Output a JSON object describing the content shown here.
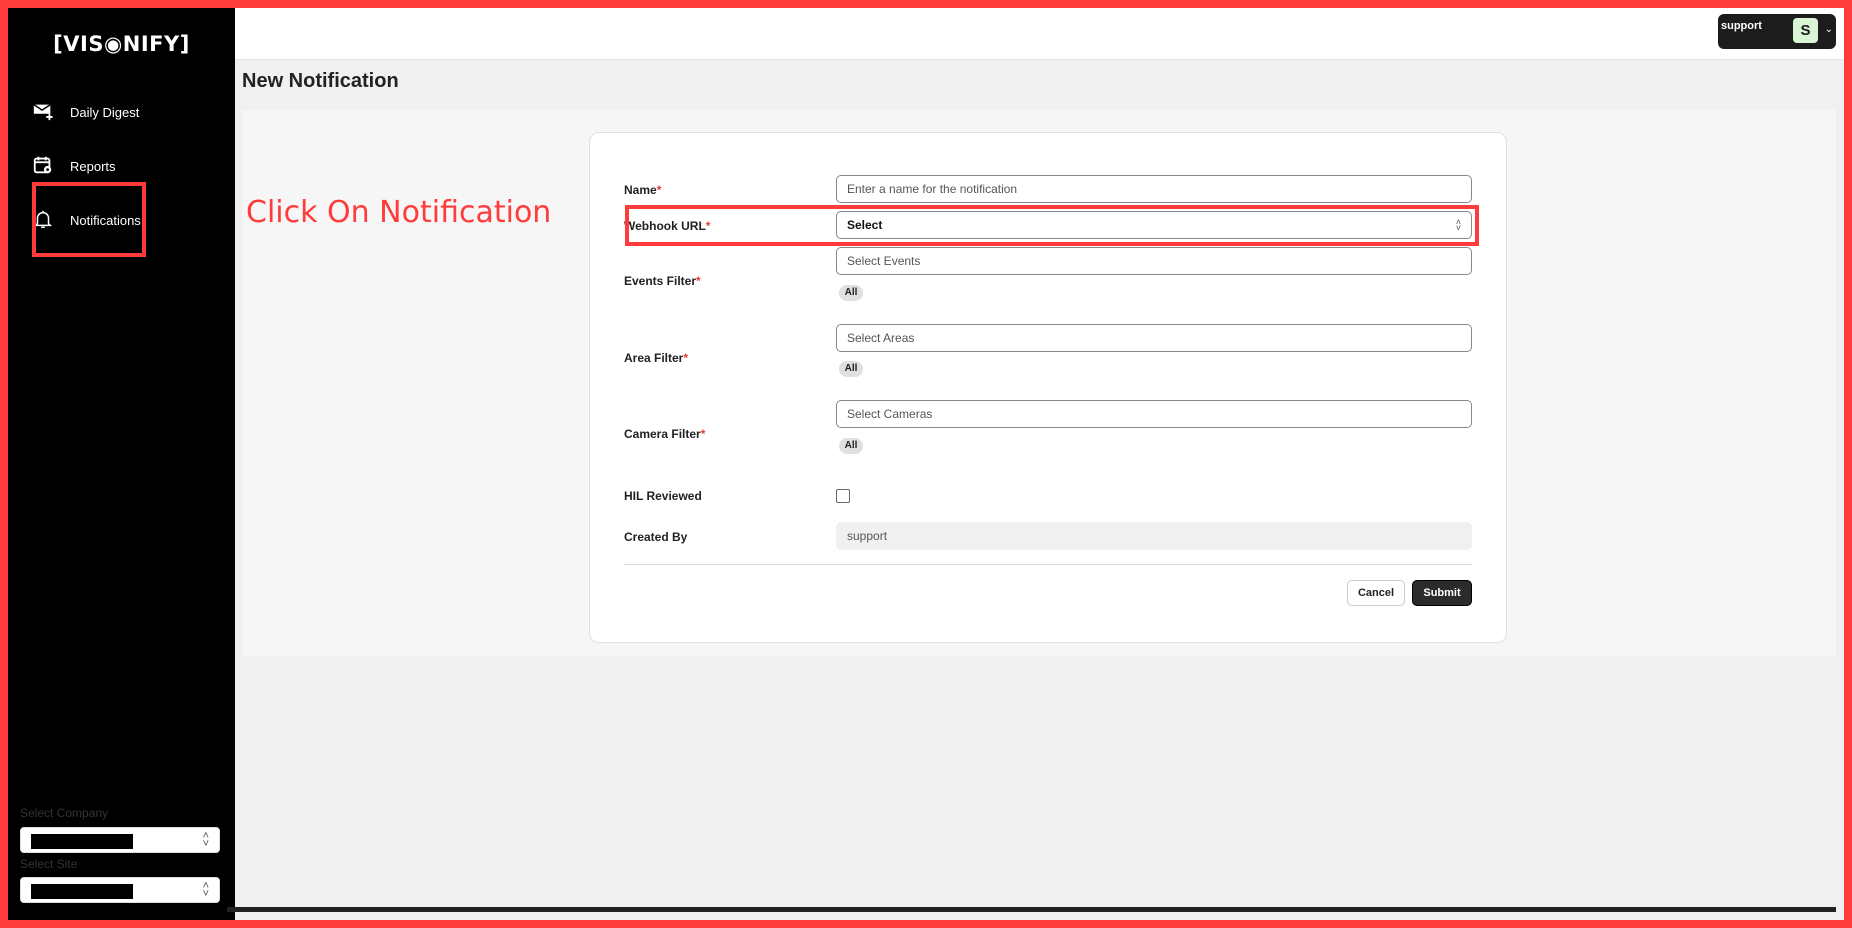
{
  "brand": {
    "logo": "[VIS◉NIFY]"
  },
  "sidebar": {
    "items": [
      {
        "label": "Daily Digest",
        "icon": "mail-plus-icon"
      },
      {
        "label": "Reports",
        "icon": "calendar-gear-icon"
      },
      {
        "label": "Notifications",
        "icon": "bell-icon"
      }
    ],
    "company_label": "Select Company",
    "site_label": "Select Site"
  },
  "header": {
    "username": "support",
    "avatar_letter": "S"
  },
  "page": {
    "title": "New Notification"
  },
  "annotation": {
    "text": "Click On Notification",
    "color": "#ff3b3b"
  },
  "form": {
    "name": {
      "label": "Name",
      "required": "*",
      "placeholder": "Enter a name for the notification"
    },
    "webhook": {
      "label": "Webhook URL",
      "required": "*",
      "value": "Select"
    },
    "events": {
      "label": "Events Filter",
      "required": "*",
      "placeholder": "Select Events",
      "chip": "All"
    },
    "areas": {
      "label": "Area Filter",
      "required": "*",
      "placeholder": "Select Areas",
      "chip": "All"
    },
    "cameras": {
      "label": "Camera Filter",
      "required": "*",
      "placeholder": "Select Cameras",
      "chip": "All"
    },
    "hil": {
      "label": "HIL Reviewed"
    },
    "created_by": {
      "label": "Created By",
      "value": "support"
    },
    "cancel_label": "Cancel",
    "submit_label": "Submit"
  }
}
